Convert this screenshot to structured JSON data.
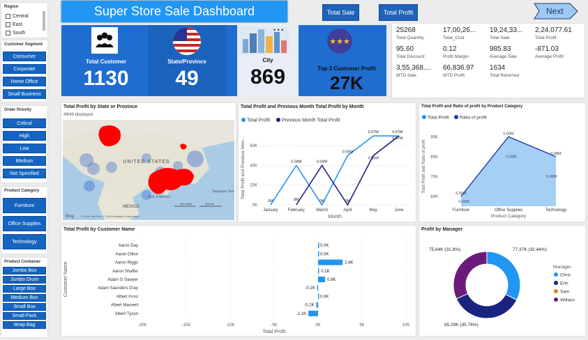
{
  "header": {
    "title": "Super Store Sale Dashboard",
    "total_sale_btn": "Total Sale",
    "total_profit_btn": "Total Profit",
    "next_btn": "Next"
  },
  "region": {
    "title": "Region",
    "items": [
      "Central",
      "East",
      "South"
    ]
  },
  "customer_segment": {
    "title": "Customer Segment",
    "items": [
      "Consumer",
      "Corporate",
      "Home Office",
      "Small Business"
    ]
  },
  "order_priority": {
    "title": "Order Priority",
    "items": [
      "Critical",
      "High",
      "Low",
      "Medium",
      "Not Specified"
    ]
  },
  "product_category": {
    "title": "Product Category",
    "items": [
      "Furniture",
      "Office Supplies",
      "Technology"
    ]
  },
  "product_container": {
    "title": "Product Container",
    "items": [
      "Jumbo Box",
      "Jumbo Drum",
      "Large Box",
      "Medium Box",
      "Small Box",
      "Small Pack",
      "Wrap Bag"
    ]
  },
  "kpis": {
    "customer": {
      "label": "Total Customer",
      "value": "1130",
      "icon": "people-icon"
    },
    "state": {
      "label": "State/Province",
      "value": "49",
      "icon": "us-flag-icon"
    },
    "city": {
      "label": "City",
      "value": "869",
      "icon": "city-icon"
    },
    "top3": {
      "label": "Top 3 Customer Profit",
      "value": "27K",
      "icon": "stars-icon"
    }
  },
  "metrics": [
    {
      "value": "25268",
      "label": "Total Quantity"
    },
    {
      "value": "17,00,26...",
      "label": "Total_Cost"
    },
    {
      "value": "19,24,33...",
      "label": "Total Sale"
    },
    {
      "value": "2,24,077.61",
      "label": "Total Profit"
    },
    {
      "value": "95.60",
      "label": "Total Discount"
    },
    {
      "value": "0.12",
      "label": "Profit Margin"
    },
    {
      "value": "985.83",
      "label": "Average Sale"
    },
    {
      "value": "-871.03",
      "label": "Average Profit"
    },
    {
      "value": "3,55,368....",
      "label": "MTD Sale"
    },
    {
      "value": "66,836.97",
      "label": "MTD Profit"
    },
    {
      "value": "1634",
      "label": "Total Returned"
    }
  ],
  "map": {
    "title": "Total Profit by State or Province",
    "subtitle": "49/49 displayed",
    "labels": {
      "us": "UNITED STATES",
      "mexico": "MEXICO",
      "gulf": "Gulf of Mexico",
      "sargasso": "Sargasso Sea",
      "scale_mi": "500 miles",
      "scale_km": "500 km",
      "copyright": "© 2024 TomTom, © 2024 Microsoft Corporation"
    },
    "bing": "Bing"
  },
  "line_chart": {
    "title": "Total Profit and Previous Month Total Profit by Month",
    "legend": [
      "Total Profit",
      "Previous Month Total Profit"
    ],
    "colors": [
      "#2196f3",
      "#1a237e"
    ]
  },
  "area_chart": {
    "title": "Total Profit and Ratio of profit by Product Category",
    "legend": [
      "Total Profit",
      "Ratio of profit"
    ],
    "colors": [
      "#2196f3",
      "#1a3aa8"
    ]
  },
  "bar_chart": {
    "title": "Total Profit by Customer Name"
  },
  "donut": {
    "title": "Profit by Manager",
    "legend_title": "Manager",
    "slices": [
      {
        "name": "Chris",
        "label": "77.37K (32.44%)",
        "color": "#2196f3"
      },
      {
        "name": "Erin",
        "label": "85.29K (35.76%)",
        "color": "#1a237e"
      },
      {
        "name": "Sam",
        "label": "",
        "color": "#e67e22"
      },
      {
        "name": "William",
        "label": "75.84K (31.8%)",
        "color": "#6a1b7a"
      }
    ]
  },
  "chart_data": [
    {
      "type": "line",
      "title": "Total Profit and Previous Month Total Profit by Month",
      "xlabel": "Month",
      "ylabel": "Total Profit and Previous Mon...",
      "categories": [
        "January",
        "February",
        "March",
        "April",
        "May",
        "June"
      ],
      "yticks": [
        "0K",
        "20K",
        "40K",
        "60K"
      ],
      "ylim": [
        0,
        75000
      ],
      "series": [
        {
          "name": "Total Profit",
          "values": [
            0,
            40000,
            0,
            50000,
            70000,
            70000
          ],
          "labels": [
            "0M",
            "0.04M",
            "0M",
            "0.05M",
            "0.07M",
            "0.07M"
          ]
        },
        {
          "name": "Previous Month Total Profit",
          "values": [
            null,
            0,
            40000,
            0,
            50000,
            70000
          ],
          "labels": [
            "",
            "0M",
            "0.04M",
            "0M",
            "0.05M",
            "0.07M"
          ]
        }
      ]
    },
    {
      "type": "area",
      "title": "Total Profit and Ratio of profit by Product Category",
      "xlabel": "Product Category",
      "ylabel": "Total Profit and Ratio of profit",
      "categories": [
        "Furniture",
        "Office Supplies",
        "Technology"
      ],
      "yticks": [
        "60K",
        "70K",
        "80K",
        "90K"
      ],
      "ylim": [
        55000,
        95000
      ],
      "series": [
        {
          "name": "Total Profit",
          "values": [
            60000,
            90000,
            80000
          ],
          "labels": [
            "0.06M",
            "0.09M",
            "0.08M"
          ]
        },
        {
          "name": "Ratio of profit",
          "values": [
            60000,
            90000,
            80000
          ],
          "labels": [
            "0.06M",
            "0.09M",
            "0.08M"
          ]
        }
      ]
    },
    {
      "type": "bar",
      "title": "Total Profit by Customer Name",
      "xlabel": "Total Profit",
      "ylabel": "Customer Name",
      "categories": [
        "Aaron Day",
        "Aaron Dillon",
        "Aaron Riggs",
        "Aaron Shaffer",
        "Adam G Sawyer",
        "Adam Saunders Gray",
        "Albert Frost",
        "Albert Maxwell",
        "Albert Tyson"
      ],
      "values": [
        0,
        0,
        2800,
        100,
        800,
        -100,
        0,
        -200,
        -1100
      ],
      "labels": [
        "0.0K",
        "0.0K",
        "2.8K",
        "0.1K",
        "0.8K",
        "-0.1K",
        "0.0K",
        "-0.2K",
        "-1.1K"
      ],
      "xticks": [
        "-20K",
        "-15K",
        "-10K",
        "-5K",
        "0K",
        "5K",
        "10K"
      ],
      "xlim": [
        -20000,
        10000
      ]
    },
    {
      "type": "pie",
      "title": "Profit by Manager",
      "categories": [
        "Chris",
        "Erin",
        "Sam",
        "William"
      ],
      "values": [
        77370,
        85290,
        0,
        75840
      ],
      "percent": [
        32.44,
        35.76,
        0,
        31.8
      ]
    }
  ]
}
